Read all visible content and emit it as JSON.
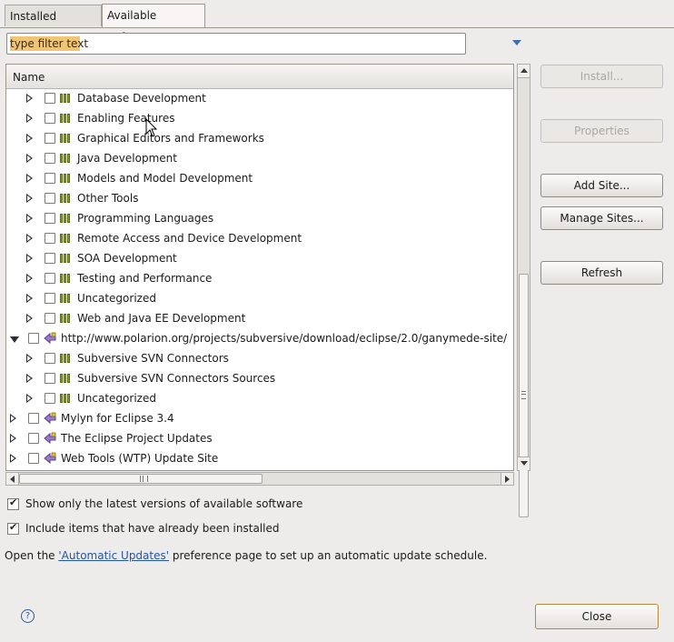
{
  "tabs": [
    {
      "label": "Installed Software"
    },
    {
      "label": "Available Software"
    }
  ],
  "filter": {
    "value": "type filter text"
  },
  "tree": {
    "header": "Name",
    "rows": [
      {
        "label": "Database Development",
        "level": 1,
        "expanded": false,
        "icon": "category-icon"
      },
      {
        "label": "Enabling Features",
        "level": 1,
        "expanded": false,
        "icon": "category-icon"
      },
      {
        "label": "Graphical Editors and Frameworks",
        "level": 1,
        "expanded": false,
        "icon": "category-icon"
      },
      {
        "label": "Java Development",
        "level": 1,
        "expanded": false,
        "icon": "category-icon"
      },
      {
        "label": "Models and Model Development",
        "level": 1,
        "expanded": false,
        "icon": "category-icon"
      },
      {
        "label": "Other Tools",
        "level": 1,
        "expanded": false,
        "icon": "category-icon"
      },
      {
        "label": "Programming Languages",
        "level": 1,
        "expanded": false,
        "icon": "category-icon"
      },
      {
        "label": "Remote Access and Device Development",
        "level": 1,
        "expanded": false,
        "icon": "category-icon"
      },
      {
        "label": "SOA Development",
        "level": 1,
        "expanded": false,
        "icon": "category-icon"
      },
      {
        "label": "Testing and Performance",
        "level": 1,
        "expanded": false,
        "icon": "category-icon"
      },
      {
        "label": "Uncategorized",
        "level": 1,
        "expanded": false,
        "icon": "category-icon"
      },
      {
        "label": "Web and Java EE Development",
        "level": 1,
        "expanded": false,
        "icon": "category-icon"
      },
      {
        "label": "http://www.polarion.org/projects/subversive/download/eclipse/2.0/ganymede-site/",
        "level": 0,
        "expanded": true,
        "icon": "update-site-icon"
      },
      {
        "label": "Subversive SVN Connectors",
        "level": 1,
        "expanded": false,
        "icon": "category-icon"
      },
      {
        "label": "Subversive SVN Connectors Sources",
        "level": 1,
        "expanded": false,
        "icon": "category-icon"
      },
      {
        "label": "Uncategorized",
        "level": 1,
        "expanded": false,
        "icon": "category-icon"
      },
      {
        "label": "Mylyn for Eclipse 3.4",
        "level": 0,
        "expanded": false,
        "icon": "update-site-icon"
      },
      {
        "label": "The Eclipse Project Updates",
        "level": 0,
        "expanded": false,
        "icon": "update-site-icon"
      },
      {
        "label": "Web Tools (WTP) Update Site",
        "level": 0,
        "expanded": false,
        "icon": "update-site-icon"
      }
    ]
  },
  "buttons": {
    "install": "Install...",
    "properties": "Properties",
    "add_site": "Add Site...",
    "manage_sites": "Manage Sites...",
    "refresh": "Refresh"
  },
  "options": {
    "latest_only": "Show only the latest versions of available software",
    "include_installed": "Include items that have already been installed"
  },
  "info": {
    "prefix": "Open the ",
    "link": "'Automatic Updates'",
    "suffix": " preference page to set up an automatic update schedule."
  },
  "footer": {
    "help": "?",
    "close": "Close"
  },
  "colors": {
    "filter_highlight": "#f0c676",
    "link": "#2455a3",
    "close_border": "#b6873c"
  }
}
